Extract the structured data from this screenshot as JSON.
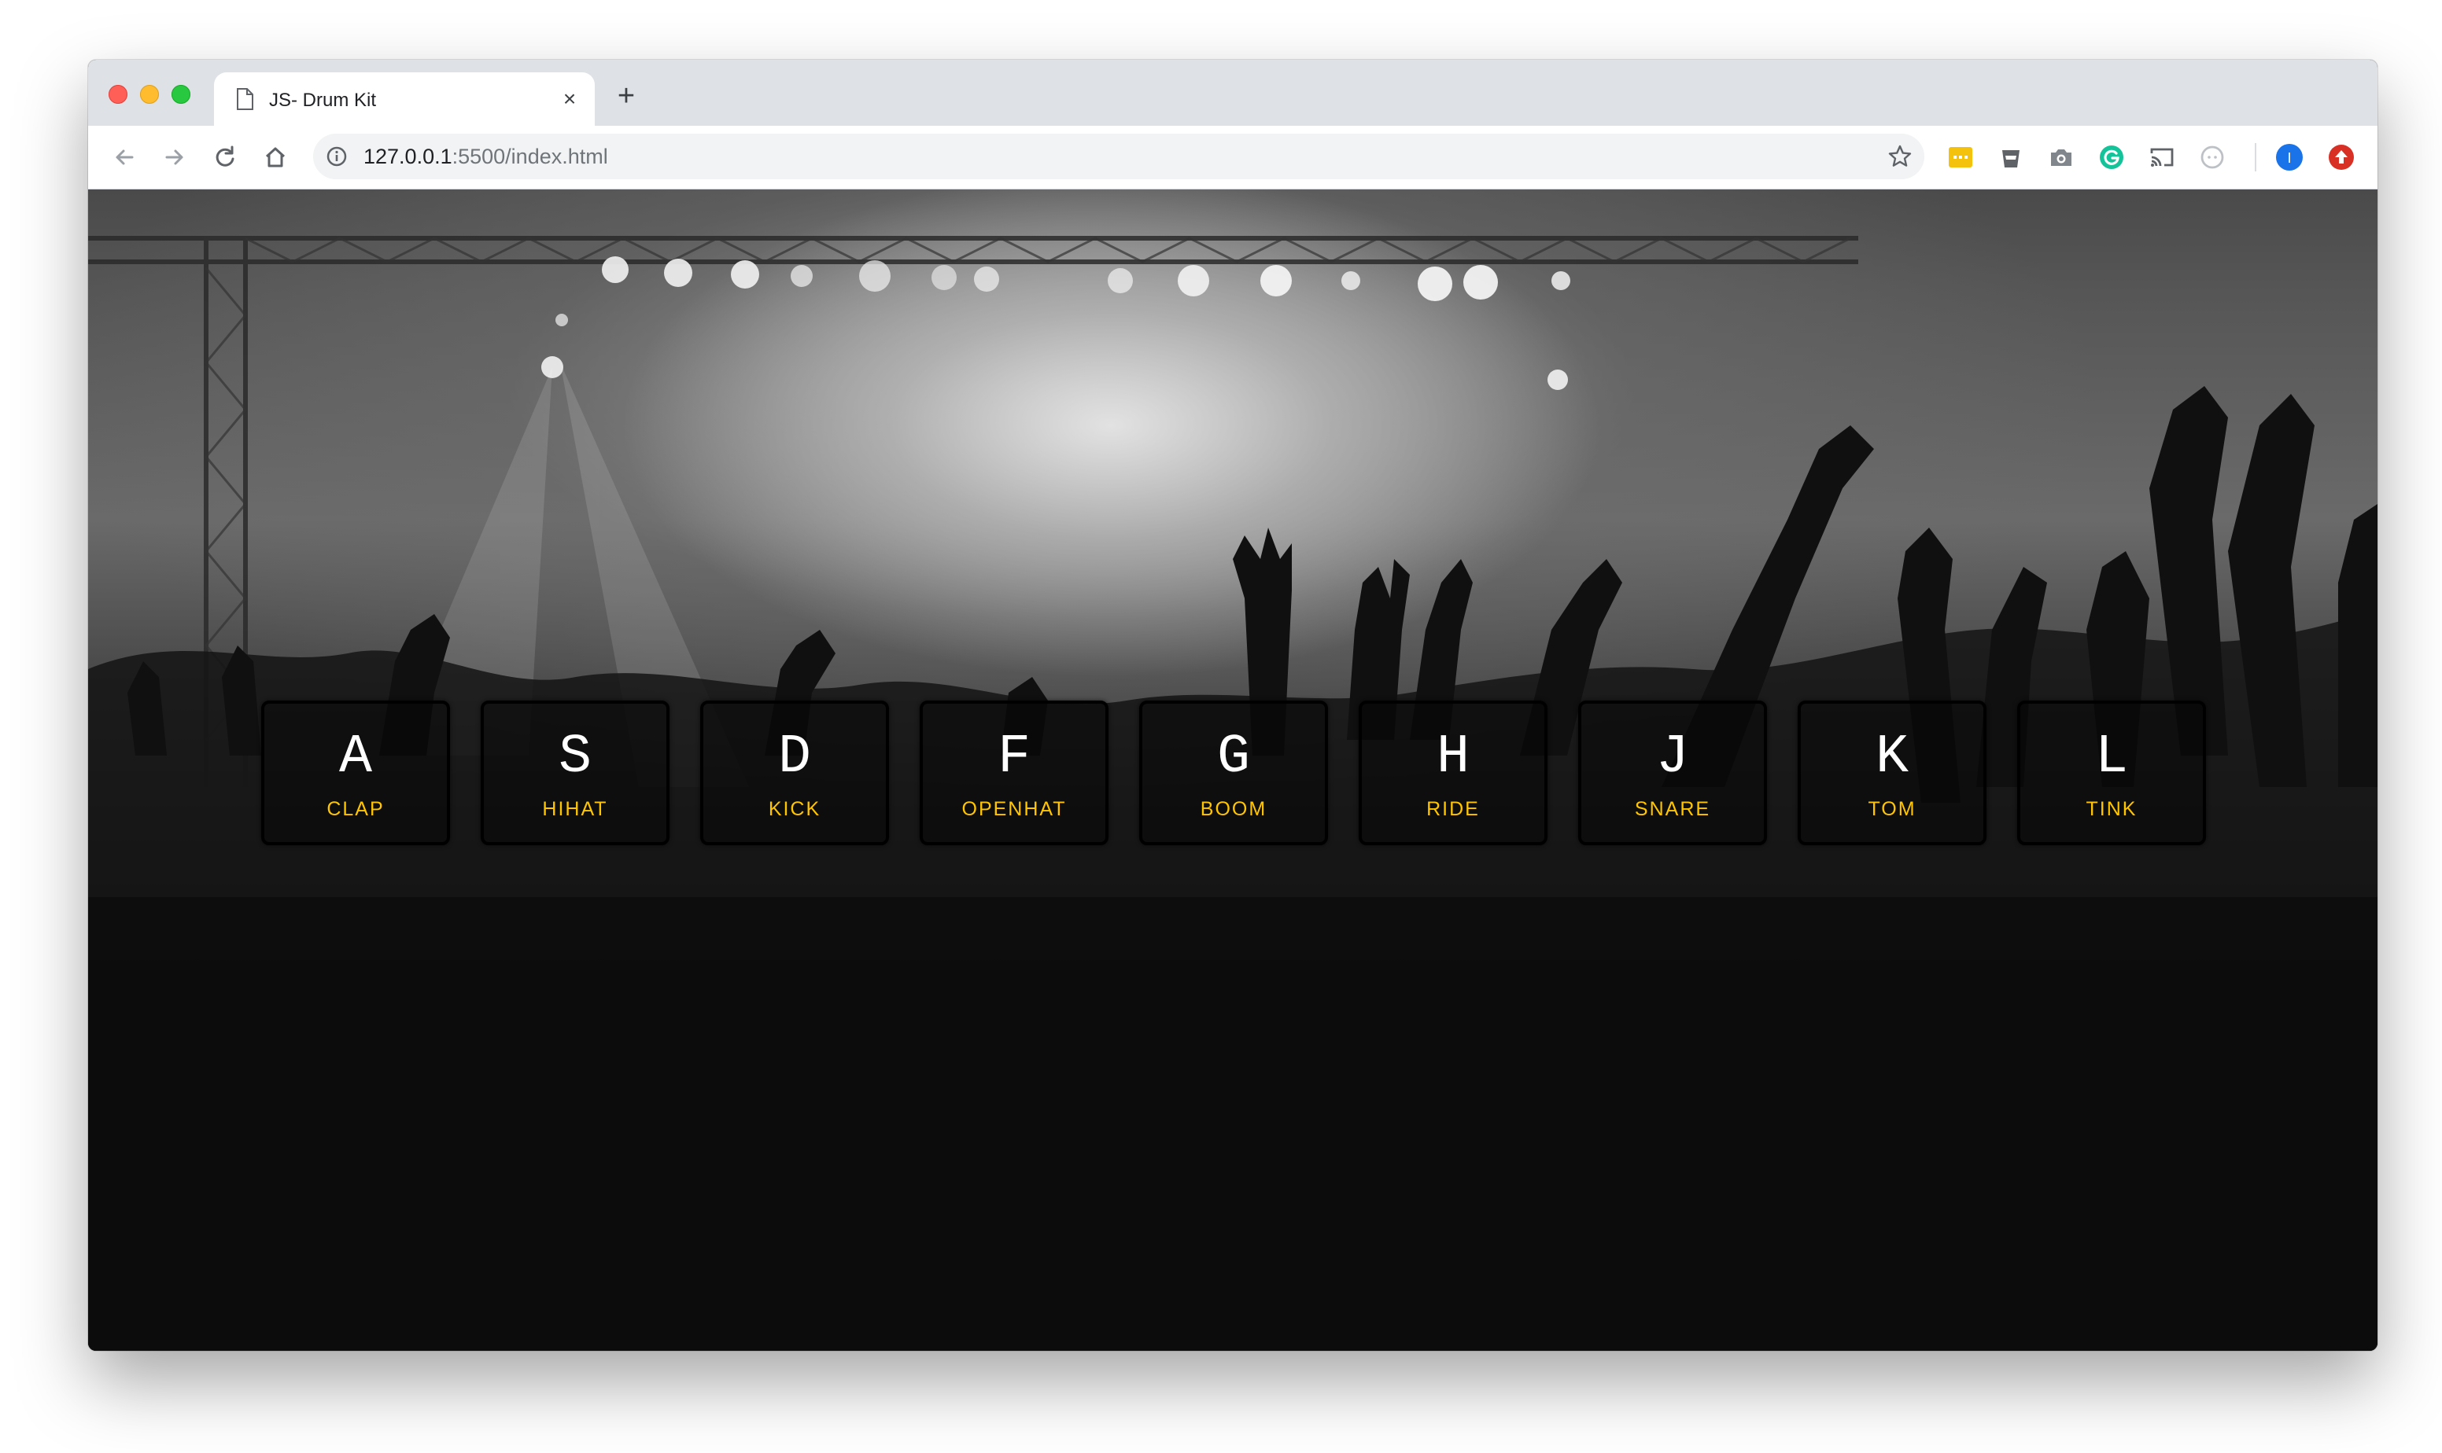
{
  "browser": {
    "tab": {
      "title": "JS- Drum Kit",
      "close_glyph": "×",
      "page_icon": "page-icon"
    },
    "new_tab_glyph": "+",
    "toolbar": {
      "back_icon": "back-arrow-icon",
      "forward_icon": "forward-arrow-icon",
      "reload_icon": "reload-icon",
      "home_icon": "home-icon"
    },
    "omnibox": {
      "url_host": "127.0.0.1",
      "url_rest": ":5500/index.html",
      "info_icon": "info-icon",
      "bookmark_icon": "star-icon"
    },
    "extensions": [
      {
        "name": "notes-extension-icon",
        "color": "#f4c20d"
      },
      {
        "name": "cup-extension-icon",
        "color": "#5f6368"
      },
      {
        "name": "camera-extension-icon",
        "color": "#5f6368"
      },
      {
        "name": "grammarly-extension-icon",
        "color": "#15c39a"
      },
      {
        "name": "cast-icon",
        "color": "#5f6368"
      },
      {
        "name": "circle-extension-icon",
        "color": "#bdc1c6"
      }
    ],
    "profile": {
      "initial": "I",
      "color": "#1a73e8"
    },
    "update_badge_color": "#d93025"
  },
  "drumkit": {
    "keys": [
      {
        "letter": "A",
        "sound": "CLAP"
      },
      {
        "letter": "S",
        "sound": "HIHAT"
      },
      {
        "letter": "D",
        "sound": "KICK"
      },
      {
        "letter": "F",
        "sound": "OPENHAT"
      },
      {
        "letter": "G",
        "sound": "BOOM"
      },
      {
        "letter": "H",
        "sound": "RIDE"
      },
      {
        "letter": "J",
        "sound": "SNARE"
      },
      {
        "letter": "K",
        "sound": "TOM"
      },
      {
        "letter": "L",
        "sound": "TINK"
      }
    ],
    "colors": {
      "letter": "#ffffff",
      "sound": "#ffc600",
      "key_border": "#000000"
    },
    "background": "concert-crowd-photo"
  }
}
